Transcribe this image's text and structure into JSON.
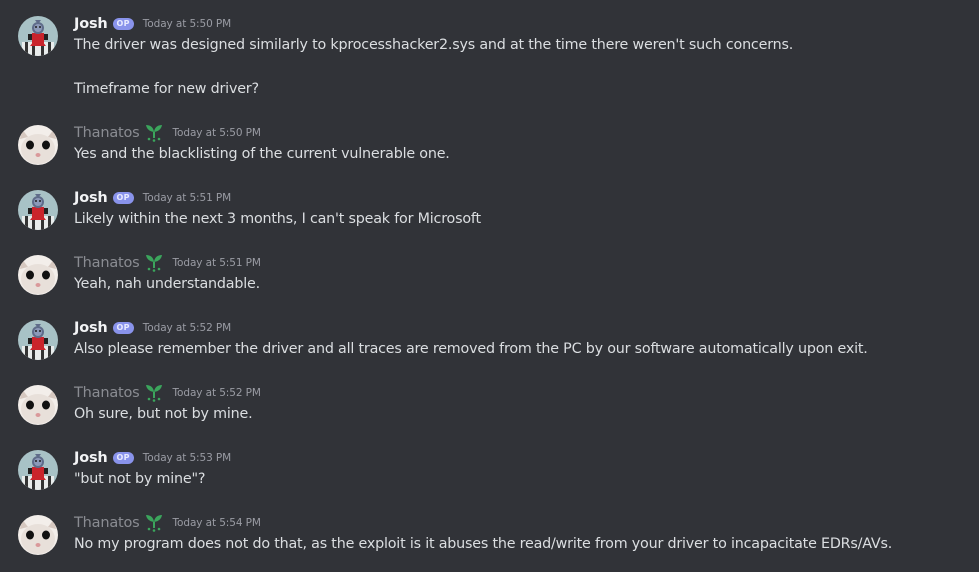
{
  "messages": [
    {
      "author": "Josh",
      "badge": "OP",
      "time": "Today at 5:50 PM",
      "lines": [
        "The driver was designed similarly to kprocesshacker2.sys and at the time there weren't such concerns.",
        "Timeframe for new driver?"
      ],
      "avatar_icon": "red-creature-avatar-icon"
    },
    {
      "author": "Thanatos",
      "role_icon": "green-sprout-icon",
      "time": "Today at 5:50 PM",
      "lines": [
        "Yes and the blacklisting of the current vulnerable one."
      ],
      "avatar_icon": "cat-avatar-icon"
    },
    {
      "author": "Josh",
      "badge": "OP",
      "time": "Today at 5:51 PM",
      "lines": [
        "Likely within the next 3 months, I can't speak for Microsoft"
      ],
      "avatar_icon": "red-creature-avatar-icon"
    },
    {
      "author": "Thanatos",
      "role_icon": "green-sprout-icon",
      "time": "Today at 5:51 PM",
      "lines": [
        "Yeah, nah understandable."
      ],
      "avatar_icon": "cat-avatar-icon"
    },
    {
      "author": "Josh",
      "badge": "OP",
      "time": "Today at 5:52 PM",
      "lines": [
        "Also please remember the driver and all traces are removed from the PC by our software automatically upon exit."
      ],
      "avatar_icon": "red-creature-avatar-icon"
    },
    {
      "author": "Thanatos",
      "role_icon": "green-sprout-icon",
      "time": "Today at 5:52 PM",
      "lines": [
        "Oh sure, but not by mine."
      ],
      "avatar_icon": "cat-avatar-icon"
    },
    {
      "author": "Josh",
      "badge": "OP",
      "time": "Today at 5:53 PM",
      "lines": [
        "\"but not by mine\"?"
      ],
      "avatar_icon": "red-creature-avatar-icon"
    },
    {
      "author": "Thanatos",
      "role_icon": "green-sprout-icon",
      "time": "Today at 5:54 PM",
      "lines": [
        "No my program does not do that, as the exploit is it abuses the read/write from your driver to incapacitate EDRs/AVs."
      ],
      "avatar_icon": "cat-avatar-icon"
    }
  ],
  "colors": {
    "background": "#313338",
    "message_text": "#dbdee1",
    "josh_name": "#f2f3f5",
    "thanatos_name": "#8a8c92",
    "op_badge": "#8993eb",
    "timestamp": "#9a9ca4",
    "role_icon": "#3ba55c"
  }
}
